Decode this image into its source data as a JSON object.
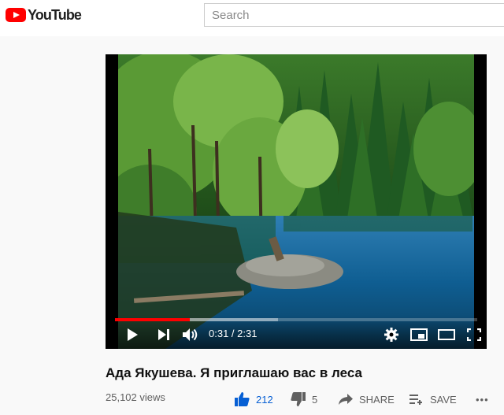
{
  "app": {
    "logo_text": "YouTube"
  },
  "search": {
    "placeholder": "Search"
  },
  "player": {
    "progress_fraction": 0.206,
    "buffered_fraction": 0.45,
    "current_time": "0:31",
    "duration": "2:31",
    "time_display": "0:31 / 2:31"
  },
  "video": {
    "title": "Ада Якушева. Я приглашаю вас в леса",
    "views": "25,102 views",
    "likes": "212",
    "dislikes": "5",
    "share_label": "SHARE",
    "save_label": "SAVE",
    "more_label": "•••"
  },
  "colors": {
    "brand": "#ff0000",
    "like": "#065fd4",
    "secondary_text": "#606060"
  },
  "icons": [
    "youtube-logo-icon",
    "play-icon",
    "next-icon",
    "volume-icon",
    "settings-icon",
    "miniplayer-icon",
    "theater-icon",
    "fullscreen-icon",
    "thumbs-up-icon",
    "thumbs-down-icon",
    "share-icon",
    "save-icon",
    "more-icon"
  ]
}
